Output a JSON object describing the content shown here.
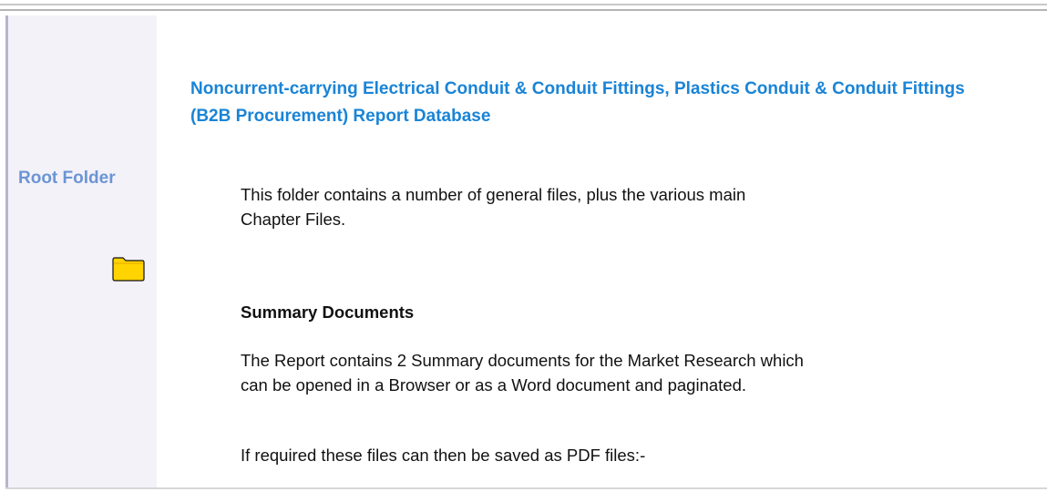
{
  "sidebar": {
    "title": "Root Folder",
    "icon": "folder-icon",
    "accent_color": "#6b95d4"
  },
  "main": {
    "title": "Noncurrent-carrying Electrical Conduit & Conduit Fittings, Plastics Conduit & Conduit Fittings (B2B Procurement) Report Database",
    "intro": "This folder contains a number of general files, plus the various main Chapter Files.",
    "summary_heading": "Summary Documents",
    "summary_text": "The Report contains 2 Summary documents for the Market Research which can be opened in a Browser or as a Word document and paginated.",
    "pdf_note": "If required these files can then be saved as PDF files:-",
    "title_color": "#1a84d6"
  }
}
